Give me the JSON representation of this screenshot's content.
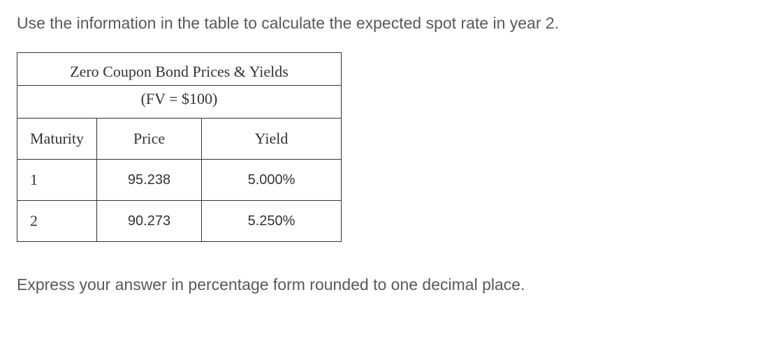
{
  "question": "Use the information in the table to calculate the expected spot rate in year 2.",
  "table": {
    "title": "Zero Coupon Bond Prices & Yields",
    "subtitle": "(FV = $100)",
    "headers": {
      "maturity": "Maturity",
      "price": "Price",
      "yield": "Yield"
    },
    "rows": [
      {
        "maturity": "1",
        "price": "95.238",
        "yield": "5.000%"
      },
      {
        "maturity": "2",
        "price": "90.273",
        "yield": "5.250%"
      }
    ]
  },
  "instruction": "Express your answer in percentage form rounded to one decimal place."
}
